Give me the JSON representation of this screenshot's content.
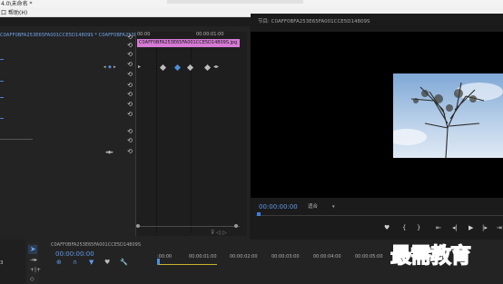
{
  "titlebar": {
    "title": "4.0\\未命名 *"
  },
  "menubar": {
    "items": [
      "口",
      "帮助(H)"
    ]
  },
  "effect_controls": {
    "header": "C0AFF0BFA253E65FA001CCE5D14809S * C0AFF0BFA253E65FA001CCE5D14809S.jpg",
    "ruler": {
      "left": "00:00",
      "right": "00:00:01:00"
    },
    "clip_label": "C0AFF0BFA253E65FA001CCE5D14809S.jpg",
    "timecode_small": "00:00:01:00"
  },
  "program": {
    "title": "节目: C0AFF0BFA253E65FA001CCE5D14809S",
    "timecode": "00:00:00:00",
    "fit": "适合",
    "controls": [
      "add-marker-icon",
      "mark-in-icon",
      "mark-out-icon",
      "go-to-in-icon",
      "step-back-icon",
      "play-icon",
      "step-forward-icon",
      "go-to-out-icon"
    ],
    "accent_color": "#5f9ae8"
  },
  "timeline": {
    "title": "C0AFF0BFA253E65FA001CCE5D14809S",
    "timecode": "00:00:00:00",
    "ruler": [
      ":00:00",
      "00:00:01:00",
      "00:00:02:00",
      "00:00:03:00",
      "00:00:04:00",
      "00:00:05:00"
    ],
    "left_label": "3"
  },
  "watermark": {
    "text": "最需教育"
  }
}
